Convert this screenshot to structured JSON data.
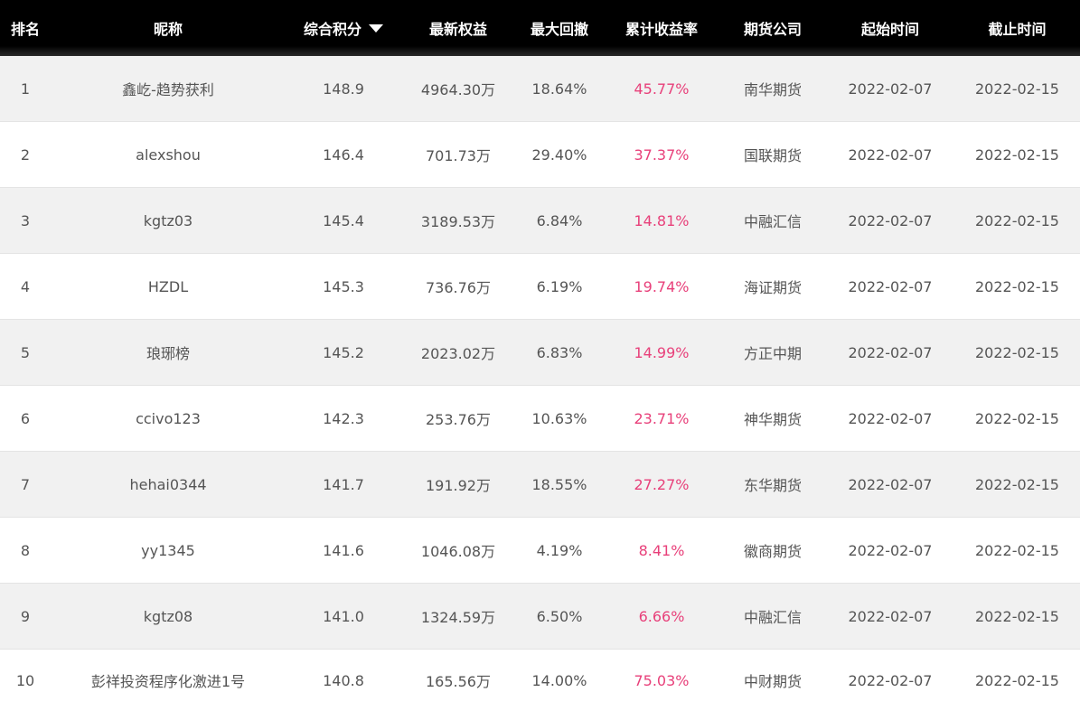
{
  "header": {
    "rank": "排名",
    "name": "昵称",
    "score": "综合积分",
    "equity": "最新权益",
    "drawdown": "最大回撤",
    "return": "累计收益率",
    "broker": "期货公司",
    "start": "起始时间",
    "end": "截止时间",
    "sort_icon": "sort-desc-icon"
  },
  "colors": {
    "header_bg": "#000000",
    "row_alt_bg": "#f1f1f1",
    "return_text": "#e8407a"
  },
  "rows": [
    {
      "rank": "1",
      "name": "鑫屹-趋势获利",
      "score": "148.9",
      "equity": "4964.30万",
      "drawdown": "18.64%",
      "return": "45.77%",
      "broker": "南华期货",
      "start": "2022-02-07",
      "end": "2022-02-15"
    },
    {
      "rank": "2",
      "name": "alexshou",
      "score": "146.4",
      "equity": "701.73万",
      "drawdown": "29.40%",
      "return": "37.37%",
      "broker": "国联期货",
      "start": "2022-02-07",
      "end": "2022-02-15"
    },
    {
      "rank": "3",
      "name": "kgtz03",
      "score": "145.4",
      "equity": "3189.53万",
      "drawdown": "6.84%",
      "return": "14.81%",
      "broker": "中融汇信",
      "start": "2022-02-07",
      "end": "2022-02-15"
    },
    {
      "rank": "4",
      "name": "HZDL",
      "score": "145.3",
      "equity": "736.76万",
      "drawdown": "6.19%",
      "return": "19.74%",
      "broker": "海证期货",
      "start": "2022-02-07",
      "end": "2022-02-15"
    },
    {
      "rank": "5",
      "name": "琅琊榜",
      "score": "145.2",
      "equity": "2023.02万",
      "drawdown": "6.83%",
      "return": "14.99%",
      "broker": "方正中期",
      "start": "2022-02-07",
      "end": "2022-02-15"
    },
    {
      "rank": "6",
      "name": "ccivo123",
      "score": "142.3",
      "equity": "253.76万",
      "drawdown": "10.63%",
      "return": "23.71%",
      "broker": "神华期货",
      "start": "2022-02-07",
      "end": "2022-02-15"
    },
    {
      "rank": "7",
      "name": "hehai0344",
      "score": "141.7",
      "equity": "191.92万",
      "drawdown": "18.55%",
      "return": "27.27%",
      "broker": "东华期货",
      "start": "2022-02-07",
      "end": "2022-02-15"
    },
    {
      "rank": "8",
      "name": "yy1345",
      "score": "141.6",
      "equity": "1046.08万",
      "drawdown": "4.19%",
      "return": "8.41%",
      "broker": "徽商期货",
      "start": "2022-02-07",
      "end": "2022-02-15"
    },
    {
      "rank": "9",
      "name": "kgtz08",
      "score": "141.0",
      "equity": "1324.59万",
      "drawdown": "6.50%",
      "return": "6.66%",
      "broker": "中融汇信",
      "start": "2022-02-07",
      "end": "2022-02-15"
    },
    {
      "rank": "10",
      "name": "彭祥投资程序化激进1号",
      "score": "140.8",
      "equity": "165.56万",
      "drawdown": "14.00%",
      "return": "75.03%",
      "broker": "中财期货",
      "start": "2022-02-07",
      "end": "2022-02-15"
    }
  ]
}
